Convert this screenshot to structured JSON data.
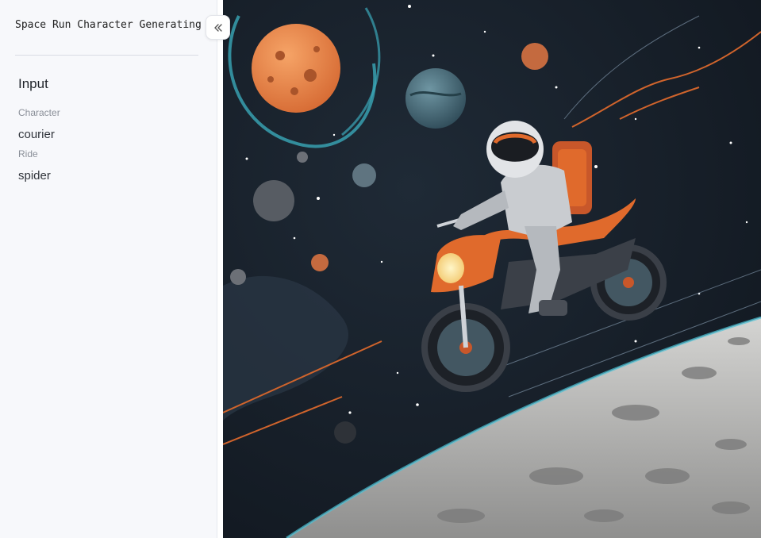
{
  "sidebar": {
    "title": "Space Run Character Generating",
    "section_heading": "Input",
    "fields": [
      {
        "label": "Character",
        "value": "courier"
      },
      {
        "label": "Ride",
        "value": "spider"
      }
    ]
  },
  "controls": {
    "collapse_icon": "double-chevron-left-icon"
  },
  "image": {
    "subject": "generated-image-astronaut-on-motorcycle"
  },
  "colors": {
    "sidebar_bg": "#f7f8fb",
    "space_bg": "#17202b",
    "planet_orange": "#e9874a",
    "bike_orange": "#e06a2c",
    "moon_surface": "#b9b9b9"
  }
}
